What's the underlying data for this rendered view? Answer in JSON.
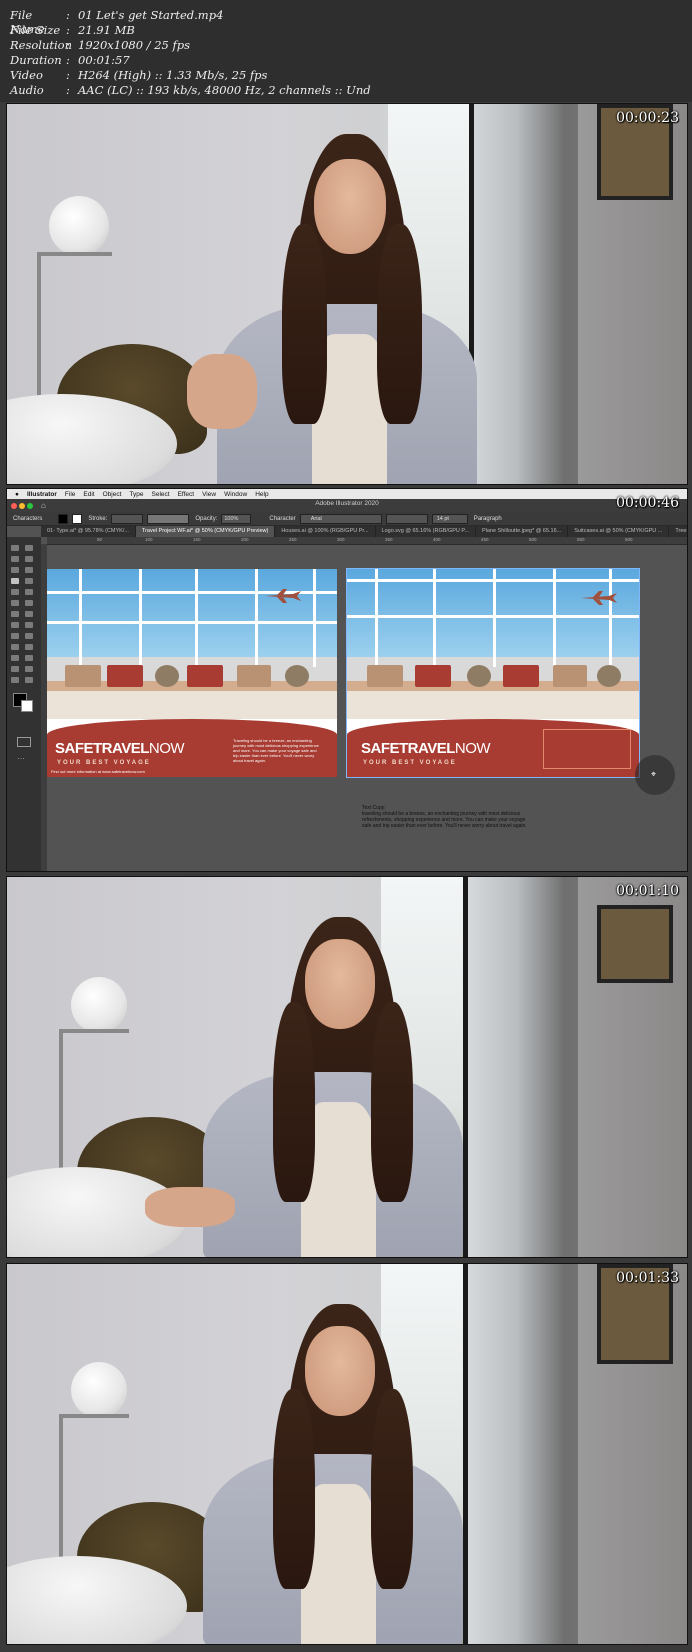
{
  "header": {
    "rows": [
      {
        "key": "File Name",
        "value": "01 Let's get Started.mp4"
      },
      {
        "key": "File Size",
        "value": "21.91 MB"
      },
      {
        "key": "Resolution",
        "value": "1920x1080 / 25 fps"
      },
      {
        "key": "Duration",
        "value": "00:01:57"
      },
      {
        "key": "Video",
        "value": "H264 (High) :: 1.33 Mb/s, 25 fps"
      },
      {
        "key": "Audio",
        "value": "AAC (LC) :: 193 kb/s, 48000 Hz, 2 channels :: Und"
      }
    ],
    "separator": ":"
  },
  "frames": [
    {
      "timestamp": "00:00:23",
      "kind": "video"
    },
    {
      "timestamp": "00:00:46",
      "kind": "screen"
    },
    {
      "timestamp": "00:01:10",
      "kind": "video"
    },
    {
      "timestamp": "00:01:33",
      "kind": "video"
    }
  ],
  "illustrator": {
    "menu": [
      "Illustrator",
      "File",
      "Edit",
      "Object",
      "Type",
      "Select",
      "Effect",
      "View",
      "Window",
      "Help"
    ],
    "window_title": "Adobe Illustrator 2020",
    "control_bar": {
      "selection": "Characters",
      "stroke_label": "Stroke:",
      "opacity_label": "Opacity:",
      "opacity_value": "100%",
      "character_label": "Character",
      "font_value": "Arial",
      "size_value": "14 pt",
      "paragraph_label": "Paragraph"
    },
    "tabs": [
      "01- Type.ai* @ 95.78% (CMYK/...",
      "Travel Project WF.ai* @ 50% (CMYK/GPU Preview)",
      "Houses.ai @ 100% (RGB/GPU Pr...",
      "Logo.svg @ 65.16% (RGB/GPU P...",
      "Plane Shilloutte.jpeg* @ 65.16...",
      "Suitcases.ai @ 50% (CMYK/GPU ...",
      "Trees.a..."
    ],
    "ruler_ticks": [
      "50",
      "100",
      "150",
      "200",
      "250",
      "300",
      "350",
      "400",
      "450",
      "500",
      "550",
      "600"
    ],
    "artboards": [
      {
        "brand_main": "SAFETRAVEL",
        "brand_suffix": "NOW",
        "slogan": "YOUR BEST VOYAGE",
        "body": "Traveling should be a breeze, an enchanting journey with most delicious shopping experience and more. You can make your voyage safe and trip easier than ever before. You'll never worry about travel again.",
        "footer": "Find out more information at www.safetravelnow.com"
      },
      {
        "brand_main": "SAFETRAVEL",
        "brand_suffix": "NOW",
        "slogan": "YOUR BEST VOYAGE"
      }
    ],
    "text_copy_label": "Text Copy:",
    "text_copy_body": "traveling should be a breeze, an enchanting journey with most delicious refreshments, shopping experience and more. You can make your voyage safe and trip easier than ever before. You'll never worry about travel again.",
    "colors": {
      "sky": "#5aa8de",
      "brand_red": "#a83b32",
      "suitcase_tan": "#b89272",
      "suitcase_red": "#a83b32",
      "plane": "#a0503d",
      "app_bg": "#535353"
    }
  }
}
